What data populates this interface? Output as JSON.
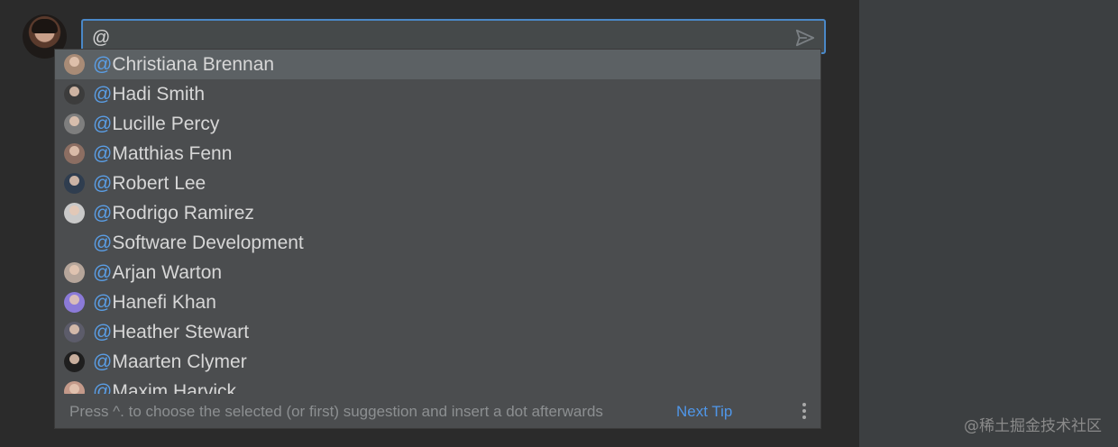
{
  "composer": {
    "input_value": "@",
    "send_icon": "send-icon"
  },
  "mention_popup": {
    "items": [
      {
        "prefix": "@",
        "name": "Christiana Brennan",
        "avatar_color": "#a88b76",
        "selected": true
      },
      {
        "prefix": "@",
        "name": "Hadi Smith",
        "avatar_color": "#3c3c3c",
        "selected": false
      },
      {
        "prefix": "@",
        "name": "Lucille Percy",
        "avatar_color": "#7e7e7e",
        "selected": false
      },
      {
        "prefix": "@",
        "name": "Matthias Fenn",
        "avatar_color": "#8c6e62",
        "selected": false
      },
      {
        "prefix": "@",
        "name": "Robert Lee",
        "avatar_color": "#2f3d4f",
        "selected": false
      },
      {
        "prefix": "@",
        "name": "Rodrigo Ramirez",
        "avatar_color": "#c9c9c9",
        "selected": false
      },
      {
        "prefix": "@",
        "name": "Software Development",
        "avatar_color": "",
        "selected": false
      },
      {
        "prefix": "@",
        "name": "Arjan Warton",
        "avatar_color": "#b5a59a",
        "selected": false
      },
      {
        "prefix": "@",
        "name": "Hanefi Khan",
        "avatar_color": "#8b7ad8",
        "selected": false
      },
      {
        "prefix": "@",
        "name": "Heather Stewart",
        "avatar_color": "#5c5c6a",
        "selected": false
      },
      {
        "prefix": "@",
        "name": "Maarten Clymer",
        "avatar_color": "#1f1f1f",
        "selected": false
      },
      {
        "prefix": "@",
        "name": "Maxim Harvick",
        "avatar_color": "#c49a8a",
        "selected": false
      }
    ],
    "footer": {
      "tip": "Press ^. to choose the selected (or first) suggestion and insert a dot afterwards",
      "next_tip_label": "Next Tip",
      "more_icon": "more-vertical-icon"
    }
  },
  "watermark": "@稀土掘金技术社区",
  "colors": {
    "accent": "#4a88c7",
    "mention": "#5a9ee6",
    "link": "#4f96e8"
  }
}
